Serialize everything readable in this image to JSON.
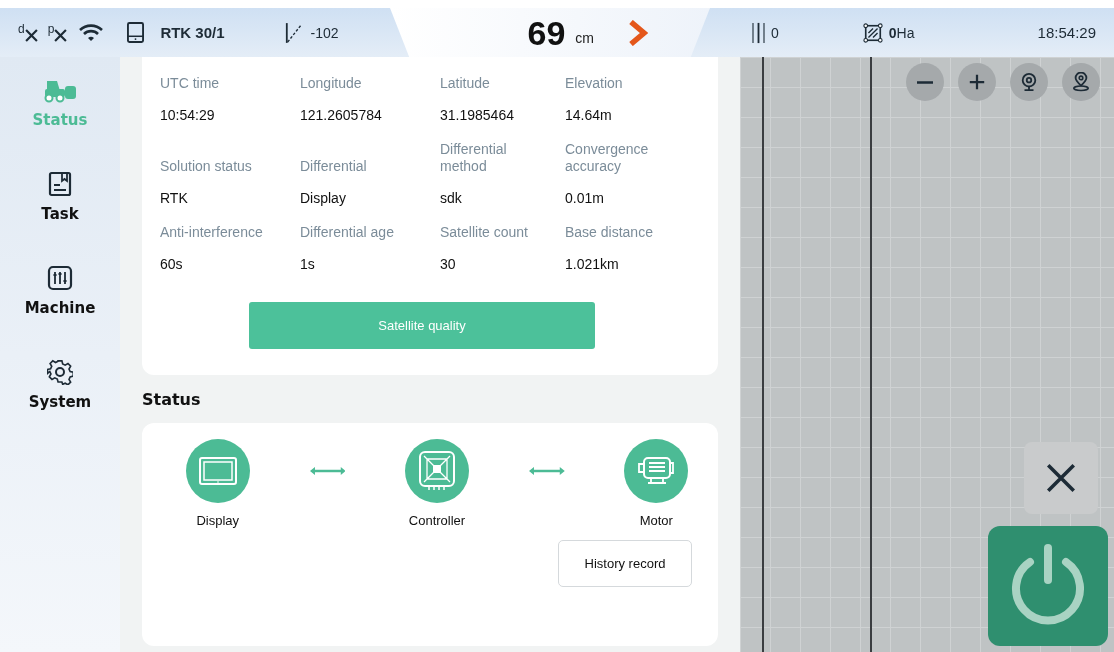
{
  "status_bar": {
    "signals": [
      {
        "letter": "d"
      },
      {
        "letter": "p"
      }
    ],
    "rtk": "RTK 30/1",
    "slope": "-102",
    "distance": "69",
    "distance_unit": "cm",
    "lane": "0",
    "area_value": "0",
    "area_unit": "Ha",
    "time": "18:54:29"
  },
  "sidebar": {
    "items": [
      {
        "label": "Status",
        "selected": true
      },
      {
        "label": "Task",
        "selected": false
      },
      {
        "label": "Machine",
        "selected": false
      },
      {
        "label": "System",
        "selected": false
      }
    ]
  },
  "gnss": {
    "fields": [
      {
        "label": "UTC time",
        "value": "10:54:29"
      },
      {
        "label": "Longitude",
        "value": "121.2605784"
      },
      {
        "label": "Latitude",
        "value": "31.1985464"
      },
      {
        "label": "Elevation",
        "value": "14.64m"
      },
      {
        "label": "Solution status",
        "value": "RTK"
      },
      {
        "label": "Differential",
        "value": "Display"
      },
      {
        "label": "Differential method",
        "value": "sdk"
      },
      {
        "label": "Convergence accuracy",
        "value": "0.01m"
      },
      {
        "label": "Anti-interference",
        "value": "60s"
      },
      {
        "label": "Differential age",
        "value": "1s"
      },
      {
        "label": "Satellite count",
        "value": "30"
      },
      {
        "label": "Base distance",
        "value": "1.021km"
      }
    ],
    "button": "Satellite quality"
  },
  "status": {
    "title": "Status",
    "devices": [
      {
        "label": "Display"
      },
      {
        "label": "Controller"
      },
      {
        "label": "Motor"
      }
    ],
    "button": "History record"
  }
}
